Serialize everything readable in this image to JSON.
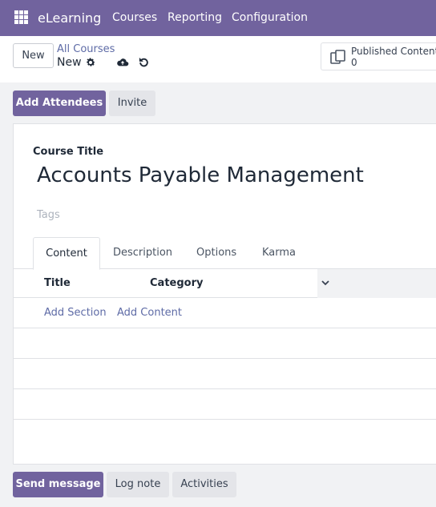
{
  "nav": {
    "app_name": "eLearning",
    "menu": [
      "Courses",
      "Reporting",
      "Configuration"
    ]
  },
  "control": {
    "new_label": "New",
    "breadcrumb_parent": "All Courses",
    "breadcrumb_current": "New"
  },
  "stat": {
    "label": "Published Contents",
    "value": "0"
  },
  "actions": {
    "add_attendees": "Add Attendees",
    "invite": "Invite"
  },
  "form": {
    "course_title_label": "Course Title",
    "course_title_value": "Accounts Payable Management",
    "tags_placeholder": "Tags",
    "tabs": [
      "Content",
      "Description",
      "Options",
      "Karma"
    ],
    "columns": [
      "Title",
      "Category"
    ],
    "add_section": "Add Section",
    "add_content": "Add Content"
  },
  "chatter": {
    "send_message": "Send message",
    "log_note": "Log note",
    "activities": "Activities"
  },
  "colors": {
    "brand": "#71639e",
    "link": "#5e6ba6"
  }
}
